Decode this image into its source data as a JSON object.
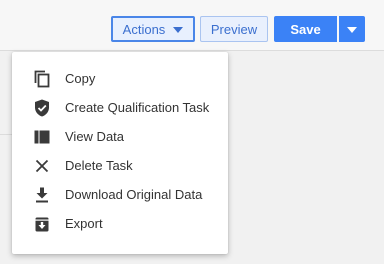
{
  "toolbar": {
    "actions_label": "Actions",
    "preview_label": "Preview",
    "save_label": "Save"
  },
  "menu": {
    "items": [
      {
        "label": "Copy",
        "icon": "copy-icon"
      },
      {
        "label": "Create Qualification Task",
        "icon": "shield-check-icon"
      },
      {
        "label": "View Data",
        "icon": "view-data-icon"
      },
      {
        "label": "Delete Task",
        "icon": "close-icon"
      },
      {
        "label": "Download Original Data",
        "icon": "download-icon"
      },
      {
        "label": "Export",
        "icon": "export-icon"
      }
    ]
  },
  "colors": {
    "accent": "#3b82f6",
    "accent_text": "#3b6fcf",
    "icon": "#3a3a3a"
  }
}
